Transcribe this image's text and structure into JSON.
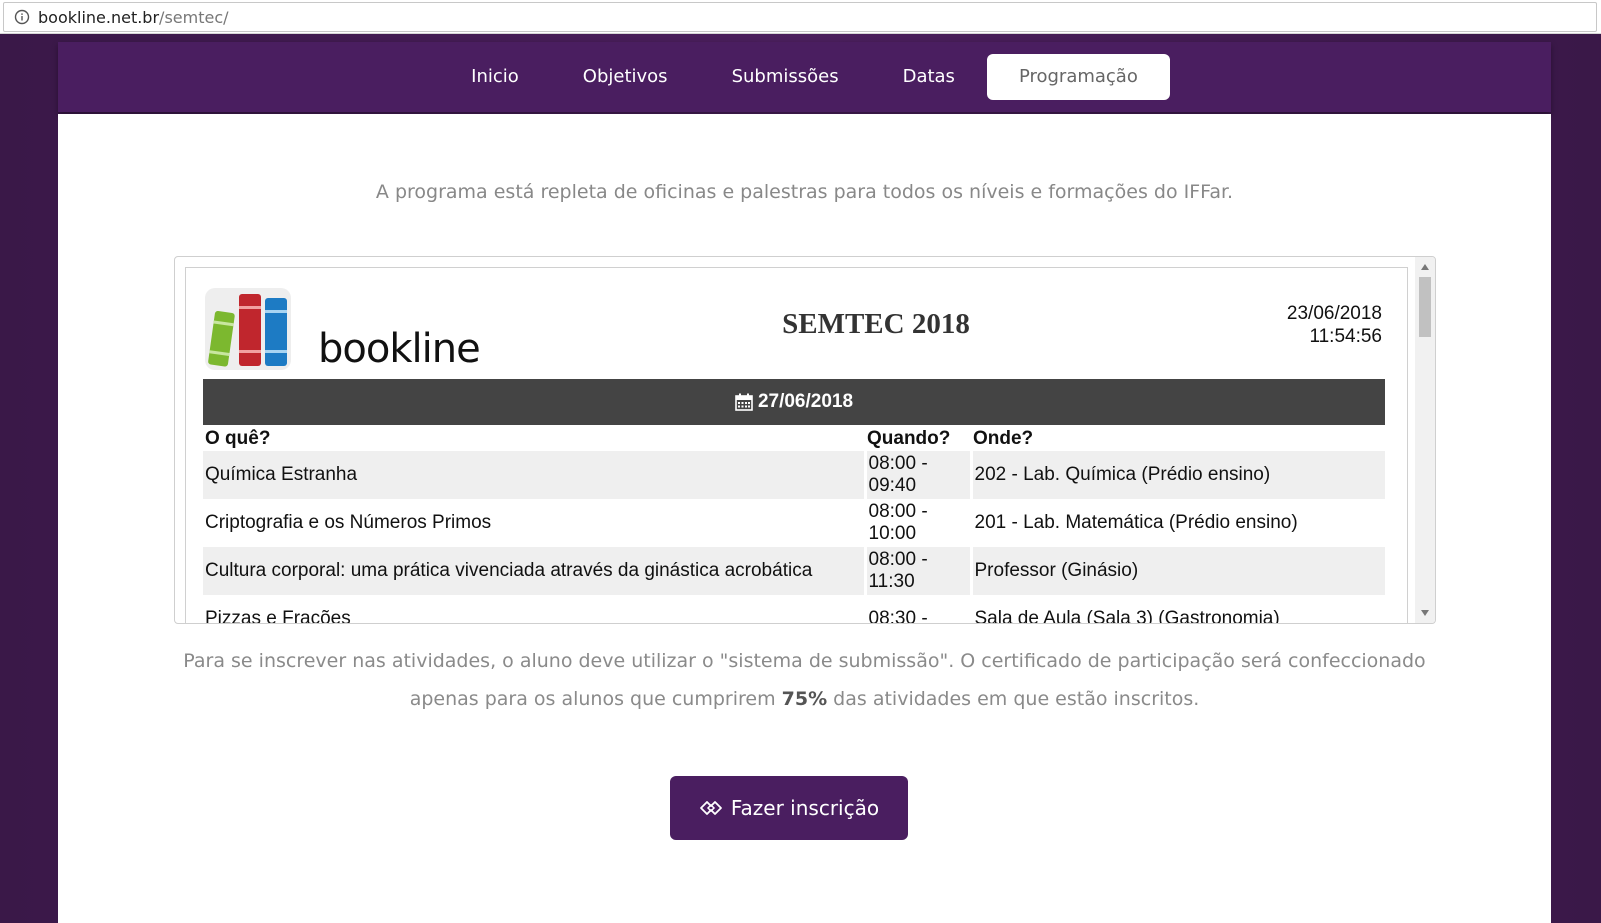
{
  "browser": {
    "url_host": "bookline.net.br",
    "url_path": "/semtec/"
  },
  "nav": {
    "items": [
      {
        "label": "Inicio"
      },
      {
        "label": "Objetivos"
      },
      {
        "label": "Submissões"
      },
      {
        "label": "Datas"
      },
      {
        "label": "Programação"
      }
    ],
    "active_index": 4
  },
  "intro": "A programa está repleta de oficinas e palestras para todos os níveis e formações do IFFar.",
  "schedule": {
    "logo_text": "bookline",
    "title": "SEMTEC 2018",
    "generated_date": "23/06/2018",
    "generated_time": "11:54:56",
    "day": "27/06/2018",
    "columns": {
      "what": "O quê?",
      "when": "Quando?",
      "where": "Onde?"
    },
    "rows": [
      {
        "what": "Química Estranha",
        "when_start": "08:00 -",
        "when_end": "09:40",
        "where": "202 - Lab. Química (Prédio ensino)"
      },
      {
        "what": "Criptografia e os Números Primos",
        "when_start": "08:00 -",
        "when_end": "10:00",
        "where": "201 - Lab. Matemática (Prédio ensino)"
      },
      {
        "what": "Cultura corporal: uma prática vivenciada através da ginástica acrobática",
        "when_start": "08:00 -",
        "when_end": "11:30",
        "where": "Professor (Ginásio)"
      },
      {
        "what": "Pizzas e Frações",
        "when_start": "08:30 -",
        "when_end": "",
        "where": "Sala de Aula (Sala 3) (Gastronomia)"
      }
    ]
  },
  "note": {
    "line1": "Para se inscrever nas atividades, o aluno deve utilizar o \"sistema de submissão\". O certificado de participação será confeccionado",
    "line2_prefix": "apenas para os alunos que cumprirem ",
    "line2_bold": "75%",
    "line2_suffix": " das atividades em que estão inscritos."
  },
  "cta": {
    "label": "Fazer inscrição"
  },
  "colors": {
    "brand_purple": "#4a1e60",
    "day_header": "#444444"
  }
}
